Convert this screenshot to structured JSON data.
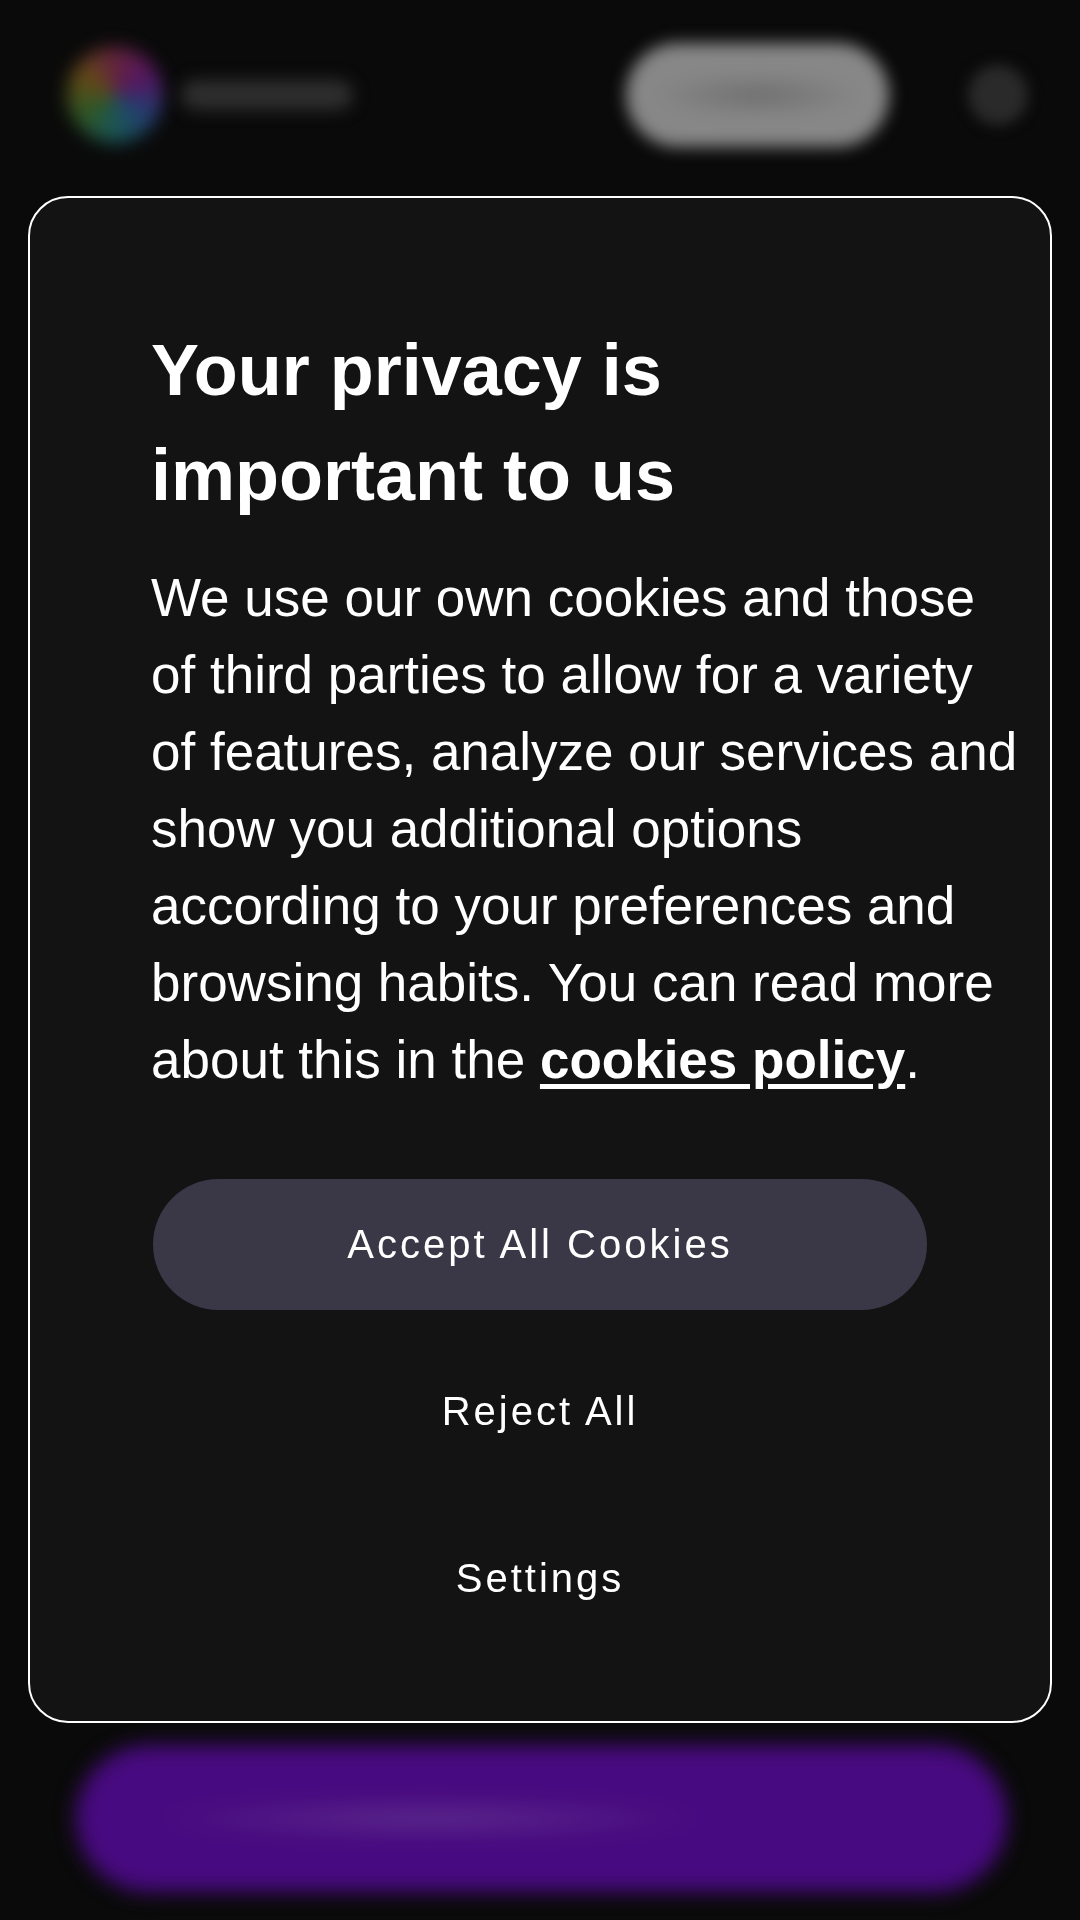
{
  "dialog": {
    "title": "Your privacy is important to us",
    "message": {
      "text": "We use our own cookies and those of third parties to allow for a variety of features, analyze our services and show you additional options according to your preferences and browsing habits. You can read more about this in the",
      "link": "cookies policy",
      "after": "."
    },
    "buttons": [
      {
        "label": "Accept All Cookies",
        "kind": "primary"
      },
      {
        "label": "Reject All",
        "kind": "text"
      },
      {
        "label": "Settings",
        "kind": "text"
      }
    ]
  }
}
